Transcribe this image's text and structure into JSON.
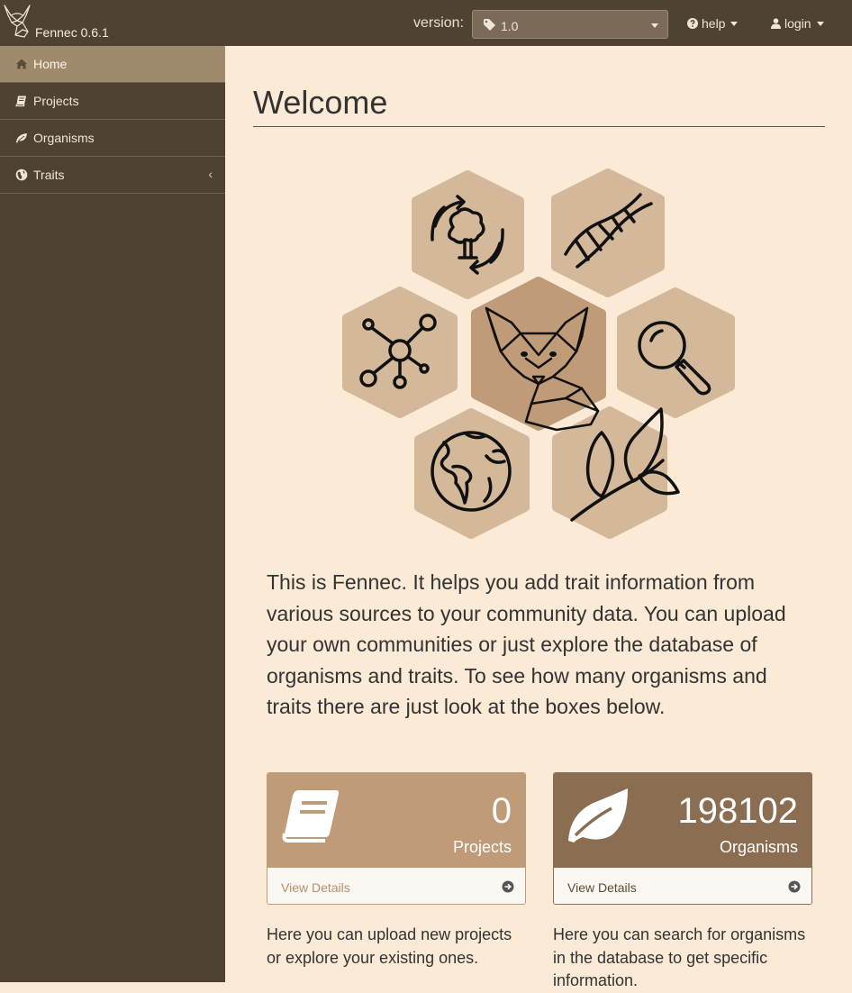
{
  "app": {
    "name": "Fennec 0.6.1"
  },
  "topbar": {
    "version_label": "version:",
    "version_value": "1.0",
    "help_label": "help",
    "login_label": "login"
  },
  "sidebar": {
    "items": [
      {
        "label": "Home",
        "icon": "home-icon"
      },
      {
        "label": "Projects",
        "icon": "book-icon"
      },
      {
        "label": "Organisms",
        "icon": "leaf-icon"
      },
      {
        "label": "Traits",
        "icon": "globe-icon"
      }
    ]
  },
  "main": {
    "title": "Welcome",
    "intro": "This is Fennec. It helps you add trait information from various sources to your community data. You can upload your own communities or just explore the database of organisms and traits. To see how many organisms and traits there are just look at the boxes below.",
    "panels": [
      {
        "count": "0",
        "label": "Projects",
        "link": "View Details",
        "description": "Here you can upload new projects or explore your existing ones."
      },
      {
        "count": "198102",
        "label": "Organisms",
        "link": "View Details",
        "description": "Here you can search for organisms in the database to get specific information."
      }
    ]
  },
  "colors": {
    "sidebar_bg": "#4f4233",
    "sidebar_active": "#a08a6d",
    "page_bg": "#faead6",
    "panel_projects": "#c09b78",
    "panel_organisms": "#8b6d52",
    "hex_light": "#d4b89a",
    "hex_center": "#c09b78"
  }
}
